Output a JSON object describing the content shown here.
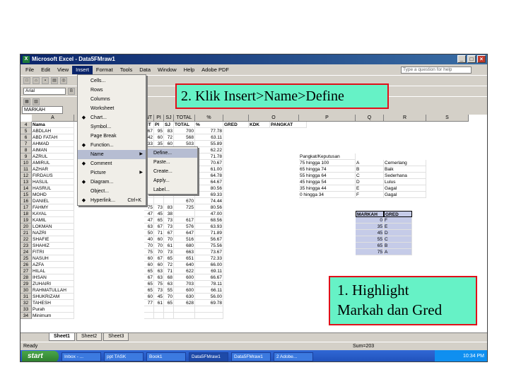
{
  "window": {
    "title": "Microsoft Excel - Data5FMraw1"
  },
  "menubar": {
    "items": [
      "File",
      "Edit",
      "View",
      "Insert",
      "Format",
      "Tools",
      "Data",
      "Window",
      "Help",
      "Adobe PDF"
    ],
    "help_placeholder": "Type a question for help"
  },
  "toolbar": {
    "font": "Arial",
    "size": "10"
  },
  "namebox": "MARKAH",
  "columns_left": [
    "A",
    "B"
  ],
  "columns_right": [
    "NT",
    "PI",
    "SJ",
    "TOTAL",
    "%",
    "",
    "O",
    "P",
    "Q",
    "R",
    "S"
  ],
  "header_row": {
    "row": "4",
    "no": "",
    "nama": "Nama",
    "nt": "NT",
    "pi": "PI",
    "sj": "SJ",
    "total": "TOTAL",
    "pct": "%",
    "gred": "GRED",
    "kdk": "KDK",
    "pangkat": "PANGKAT"
  },
  "rows": [
    {
      "n": "5",
      "name": "ABDLAH",
      "v": [
        "67",
        "95",
        "83"
      ],
      "total": "700",
      "pct": "77.78"
    },
    {
      "n": "6",
      "name": "ABD FATAH",
      "v": [
        "42",
        "60",
        "72"
      ],
      "total": "568",
      "pct": "63.11"
    },
    {
      "n": "7",
      "name": "AHMAD",
      "v": [
        "33",
        "35",
        "60"
      ],
      "total": "503",
      "pct": "55.89"
    },
    {
      "n": "8",
      "name": "AIMAN",
      "v": [
        "",
        "",
        ""
      ],
      "total": "",
      "pct": "62.22"
    },
    {
      "n": "9",
      "name": "AZRUL",
      "v": [
        "",
        "",
        ""
      ],
      "total": "",
      "pct": "71.78"
    },
    {
      "n": "10",
      "name": "AMIRUL",
      "v": [
        "",
        "",
        ""
      ],
      "total": "",
      "pct": "70.67"
    },
    {
      "n": "11",
      "name": "AZHAR",
      "v": [
        "",
        "",
        ""
      ],
      "total": "",
      "pct": "61.00"
    },
    {
      "n": "12",
      "name": "FIRDAUS",
      "v": [
        "",
        "",
        ""
      ],
      "total": "",
      "pct": "64.78"
    },
    {
      "n": "13",
      "name": "HASLIL",
      "v": [
        "",
        "",
        ""
      ],
      "total": "",
      "pct": "64.67"
    },
    {
      "n": "14",
      "name": "HASRUL",
      "v": [
        "",
        "",
        ""
      ],
      "total": "",
      "pct": "80.56"
    },
    {
      "n": "15",
      "name": "MOHD",
      "v": [
        "",
        "",
        ""
      ],
      "total": "",
      "pct": "69.33"
    },
    {
      "n": "16",
      "name": "DANIEL",
      "v": [
        "",
        "",
        ""
      ],
      "total": "670",
      "pct": "74.44"
    },
    {
      "n": "17",
      "name": "FAHMY",
      "v": [
        "75",
        "73",
        "83"
      ],
      "total": "725",
      "pct": "80.56"
    },
    {
      "n": "18",
      "name": "KAYAL",
      "v": [
        "47",
        "45",
        "38"
      ],
      "total": "",
      "pct": "47.00"
    },
    {
      "n": "19",
      "name": "KAMIL",
      "v": [
        "47",
        "65",
        "73"
      ],
      "total": "617",
      "pct": "68.56"
    },
    {
      "n": "20",
      "name": "LOKMAN",
      "v": [
        "63",
        "67",
        "73"
      ],
      "total": "576",
      "pct": "63.93"
    },
    {
      "n": "21",
      "name": "NAZRI",
      "v": [
        "50",
        "71",
        "67"
      ],
      "total": "647",
      "pct": "71.89"
    },
    {
      "n": "22",
      "name": "SHAFIE",
      "v": [
        "40",
        "60",
        "70"
      ],
      "total": "516",
      "pct": "56.67"
    },
    {
      "n": "23",
      "name": "SHAHIZ",
      "v": [
        "70",
        "70",
        "61"
      ],
      "total": "680",
      "pct": "75.56"
    },
    {
      "n": "24",
      "name": "FITRI",
      "v": [
        "75",
        "70",
        "73"
      ],
      "total": "663",
      "pct": "73.67"
    },
    {
      "n": "25",
      "name": "NASUH",
      "v": [
        "60",
        "67",
        "65"
      ],
      "total": "651",
      "pct": "72.33"
    },
    {
      "n": "26",
      "name": "AZFA",
      "v": [
        "60",
        "60",
        "72"
      ],
      "total": "640",
      "pct": "66.00"
    },
    {
      "n": "27",
      "name": "HILAL",
      "v": [
        "65",
        "63",
        "71"
      ],
      "total": "622",
      "pct": "69.11"
    },
    {
      "n": "28",
      "name": "IHSAN",
      "v": [
        "67",
        "63",
        "68"
      ],
      "total": "600",
      "pct": "66.67"
    },
    {
      "n": "29",
      "name": "ZUHAIRI",
      "v": [
        "65",
        "75",
        "63"
      ],
      "total": "703",
      "pct": "78.11"
    },
    {
      "n": "30",
      "name": "RAHMATULLAH",
      "v": [
        "65",
        "73",
        "55"
      ],
      "total": "600",
      "pct": "66.11"
    },
    {
      "n": "31",
      "name": "SHUKRIZAM",
      "v": [
        "60",
        "45",
        "70"
      ],
      "total": "630",
      "pct": "56.00"
    },
    {
      "n": "32",
      "name": "TAHESH",
      "v": [
        "77",
        "61",
        "65"
      ],
      "total": "628",
      "pct": "69.78"
    },
    {
      "n": "33",
      "name": "Purah",
      "v": [
        "",
        "",
        ""
      ],
      "total": "",
      "pct": ""
    },
    {
      "n": "34",
      "name": "Minimum",
      "v": [
        "",
        "",
        ""
      ],
      "total": "",
      "pct": ""
    }
  ],
  "pangkat_table": {
    "title": "Pangkat/Keputusan",
    "rows": [
      {
        "range": "75 hingga 100",
        "gred": "A",
        "desc": "Cemerlang"
      },
      {
        "range": "65 hingga 74",
        "gred": "B",
        "desc": "Baik"
      },
      {
        "range": "55 hingga 64",
        "gred": "C",
        "desc": "Sederhana"
      },
      {
        "range": "45 hingga 54",
        "gred": "D",
        "desc": "Lulus"
      },
      {
        "range": "35 hingga 44",
        "gred": "E",
        "desc": "Gagal"
      },
      {
        "range": "0 hingga 34",
        "gred": "F",
        "desc": "Gagal"
      }
    ]
  },
  "markah_gred": {
    "headers": [
      "MARKAH",
      "GRED"
    ],
    "rows": [
      {
        "m": "0",
        "g": "F"
      },
      {
        "m": "35",
        "g": "E"
      },
      {
        "m": "45",
        "g": "D"
      },
      {
        "m": "55",
        "g": "C"
      },
      {
        "m": "65",
        "g": "B"
      },
      {
        "m": "75",
        "g": "A"
      }
    ]
  },
  "insert_menu": {
    "items": [
      {
        "label": "Cells...",
        "icon": ""
      },
      {
        "label": "Rows",
        "icon": ""
      },
      {
        "label": "Columns",
        "icon": ""
      },
      {
        "label": "Worksheet",
        "icon": ""
      },
      {
        "label": "Chart...",
        "icon": "chart-icon"
      },
      {
        "label": "Symbol...",
        "icon": ""
      },
      {
        "label": "Page Break",
        "icon": ""
      },
      {
        "label": "Function...",
        "icon": "function-icon"
      },
      {
        "label": "Name",
        "icon": "",
        "arrow": "▶",
        "highlight": true
      },
      {
        "label": "Comment",
        "icon": "comment-icon"
      },
      {
        "label": "Picture",
        "icon": "",
        "arrow": "▶"
      },
      {
        "label": "Diagram...",
        "icon": "diagram-icon"
      },
      {
        "label": "Object...",
        "icon": ""
      },
      {
        "label": "Hyperlink...",
        "icon": "hyperlink-icon",
        "shortcut": "Ctrl+K"
      }
    ]
  },
  "name_submenu": {
    "items": [
      "Define...",
      "Paste...",
      "Create...",
      "Apply...",
      "Label..."
    ]
  },
  "sheet_tabs": [
    "Sheet1",
    "Sheet2",
    "Sheet3"
  ],
  "status": {
    "ready": "Ready",
    "sum": "Sum=203"
  },
  "taskbar": {
    "start": "start",
    "tasks": [
      "Inbox - ...",
      "ppt TASK",
      "Book1",
      "Data5FMraw1",
      "Data5FMraw1",
      "2 Adobe..."
    ],
    "clock": "10:34 PM"
  },
  "callouts": {
    "step2": "2. Klik Insert>Name>Define",
    "step1_line1": "1. Highlight",
    "step1_line2": "Markah dan Gred"
  }
}
